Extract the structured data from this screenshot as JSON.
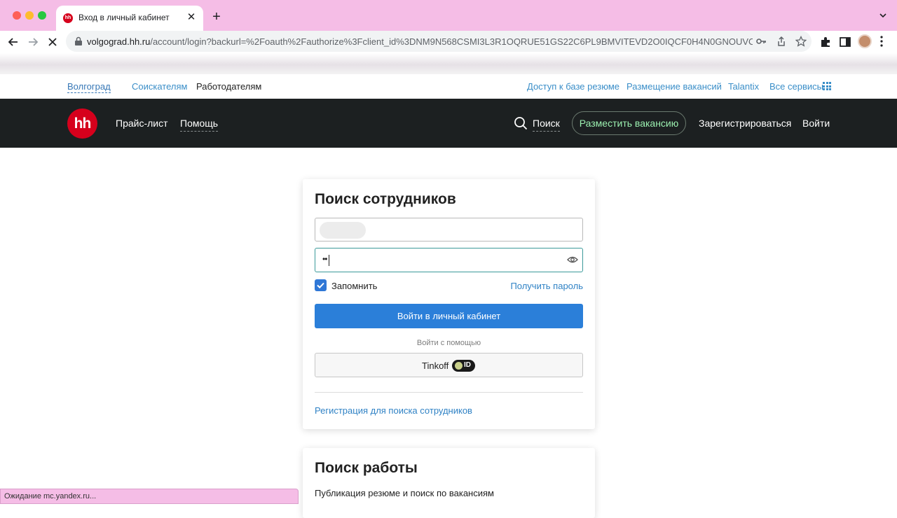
{
  "browser": {
    "tab_title": "Вход в личный кабинет",
    "tab_favicon_text": "hh",
    "url_host": "volgograd.hh.ru",
    "url_rest": "/account/login?backurl=%2Foauth%2Fauthorize%3Fclient_id%3DNM9N568CSMI3L3R1OQRUE51GS22C6PL9BMVITEVD2O0IQCF0H4N0GNOUVC...",
    "status_text": "Ожидание mc.yandex.ru..."
  },
  "subnav": {
    "city": "Волгоград",
    "seekers": "Соискателям",
    "employers": "Работодателям",
    "resume_db": "Доступ к базе резюме",
    "post_jobs": "Размещение вакансий",
    "talantix": "Talantix",
    "all_services": "Все сервисы"
  },
  "mainnav": {
    "logo": "hh",
    "price_list": "Прайс-лист",
    "help": "Помощь",
    "search": "Поиск",
    "post_vacancy": "Разместить вакансию",
    "register": "Зарегистрироваться",
    "login": "Войти"
  },
  "login_card": {
    "title": "Поиск сотрудников",
    "password_value": "••",
    "remember_label": "Запомнить",
    "remember_checked": true,
    "get_password": "Получить пароль",
    "submit": "Войти в личный кабинет",
    "via_label": "Войти с помощью",
    "tinkoff_label": "Tinkoff",
    "tinkoff_badge": "ID",
    "register_link": "Регистрация для поиска сотрудников"
  },
  "job_card": {
    "title": "Поиск работы",
    "subtitle": "Публикация резюме и поиск по вакансиям"
  },
  "colors": {
    "brand_red": "#d6001c",
    "primary_blue": "#2b7fd9",
    "header_dark": "#1c2021",
    "accent_green": "#9bf0b0",
    "chrome_pink": "#f5bde6"
  }
}
